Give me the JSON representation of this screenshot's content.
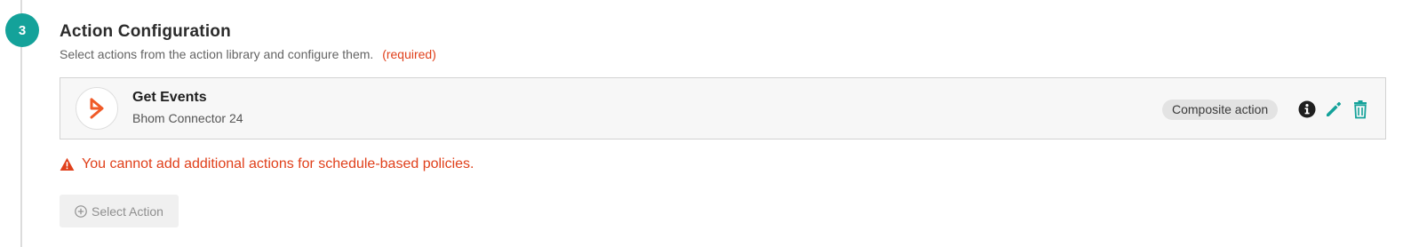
{
  "step": {
    "number": "3",
    "title": "Action Configuration",
    "description": "Select actions from the action library and configure them.",
    "required_label": "(required)"
  },
  "action": {
    "name": "Get Events",
    "connector": "Bhom Connector 24",
    "type_badge": "Composite action",
    "logo_icon": "bmc-logo-icon",
    "icons": [
      "info-icon",
      "edit-pencil-icon",
      "delete-trash-icon"
    ]
  },
  "warning": {
    "icon": "warning-triangle-icon",
    "text": "You cannot add additional actions for schedule-based policies."
  },
  "select_action": {
    "icon": "plus-circle-icon",
    "label": "Select Action",
    "disabled": true
  },
  "colors": {
    "accent": "#14a29a",
    "warning": "#e0401b",
    "logo": "#f05a28"
  }
}
